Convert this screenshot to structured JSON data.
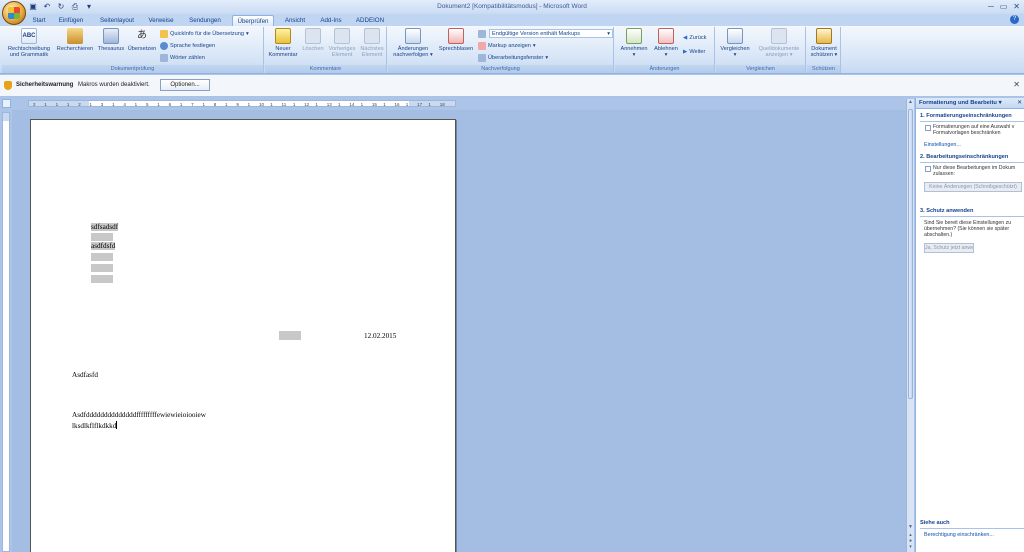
{
  "window": {
    "title": "Dokument2 [Kompatibilitätsmodus] - Microsoft Word"
  },
  "tabs": [
    {
      "label": "Start"
    },
    {
      "label": "Einfügen"
    },
    {
      "label": "Seitenlayout"
    },
    {
      "label": "Verweise"
    },
    {
      "label": "Sendungen"
    },
    {
      "label": "Überprüfen"
    },
    {
      "label": "Ansicht"
    },
    {
      "label": "Add-Ins"
    },
    {
      "label": "ADDEION"
    }
  ],
  "ribbon": {
    "dokumentpruefung": {
      "label": "Dokumentprüfung",
      "spelling": "Rechtschreibung und Grammatik",
      "research": "Recherchieren",
      "thesaurus": "Thesaurus",
      "translate": "Übersetzen",
      "quickinfo": "QuickInfo für die Übersetzung",
      "language": "Sprache festlegen",
      "wordcount": "Wörter zählen"
    },
    "kommentare": {
      "label": "Kommentare",
      "new": "Neuer Kommentar",
      "delete": "Löschen",
      "previous": "Vorheriges Element",
      "next": "Nächstes Element"
    },
    "nachverfolgung": {
      "label": "Nachverfolgung",
      "track": "Änderungen nachverfolgen",
      "balloons": "Sprechblasen",
      "markup_combo": "Endgültige Version enthält Markups",
      "show_markup": "Markup anzeigen",
      "review_pane": "Überarbeitungsfenster"
    },
    "aenderungen": {
      "label": "Änderungen",
      "accept": "Annehmen",
      "reject": "Ablehnen",
      "back": "Zurück",
      "forward": "Weiter"
    },
    "vergleichen": {
      "label": "Vergleichen",
      "compare": "Vergleichen",
      "source": "Quelldokumente anzeigen"
    },
    "schuetzen": {
      "label": "Schützen",
      "protect": "Dokument schützen"
    }
  },
  "security_bar": {
    "title": "Sicherheitswarnung",
    "message": "Makros wurden deaktiviert.",
    "options_button": "Optionen..."
  },
  "ruler": {
    "ticks": [
      "2",
      "1",
      "1",
      "1",
      "2",
      "1",
      "3",
      "1",
      "4",
      "1",
      "5",
      "1",
      "6",
      "1",
      "7",
      "1",
      "8",
      "1",
      "9",
      "1",
      "10",
      "1",
      "11",
      "1",
      "12",
      "1",
      "13",
      "1",
      "14",
      "1",
      "15",
      "1",
      "16",
      "1",
      "17",
      "1",
      "18"
    ]
  },
  "document": {
    "line1": "sdfsadsdf",
    "line2": "asdfdsfd",
    "date": "12.02.2015",
    "line3": "Asdfasfd",
    "line4": "Asdfddddddddddddddfffffffffewiewieioiooiew",
    "line5": "lksdlkflflkdkkd"
  },
  "task_pane": {
    "title": "Formatierung und Bearbeitu",
    "section1": "1. Formatierungseinschränkungen",
    "section1_check": "Formatierungen auf eine Auswahl v",
    "section1_check2": "Formatvorlagen beschränken",
    "settings_link": "Einstellungen...",
    "section2": "2. Bearbeitungseinschränkungen",
    "section2_check": "Nur diese Bearbeitungen im Dokum",
    "section2_check2": "zulassen:",
    "section2_combo": "Keine Änderungen (Schreibgeschützt)",
    "section3": "3. Schutz anwenden",
    "section3_text1": "Sind Sie bereit diese Einstellungen zu",
    "section3_text2": "übernehmen? (Sie können sie später",
    "section3_text3": "abschalten.)",
    "section3_button": "Ja, Schutz jetzt anwenden",
    "see_also": "Siehe auch",
    "permission_link": "Berechtigung einschränken..."
  },
  "colors": {
    "ribbon_text": "#15428b",
    "doc_background": "#a3bde3",
    "shading": "#c8c8c8"
  }
}
